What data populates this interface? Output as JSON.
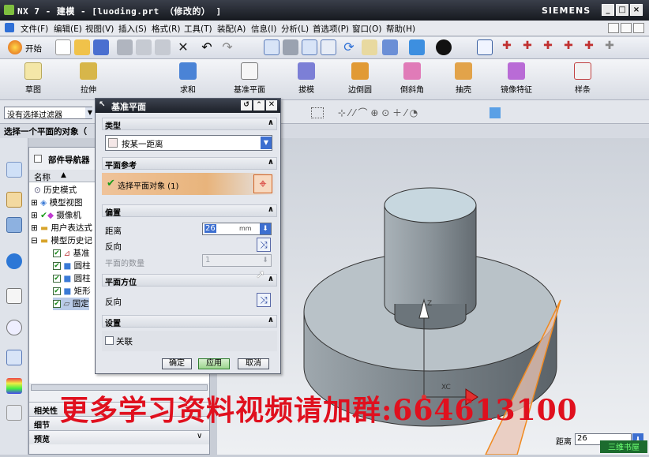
{
  "window": {
    "title": "NX 7 - 建模 - [luoding.prt （修改的） ]",
    "brand": "SIEMENS",
    "controls": [
      "_",
      "□",
      "×"
    ]
  },
  "menubar": {
    "items": [
      "文件(F)",
      "编辑(E)",
      "视图(V)",
      "插入(S)",
      "格式(R)",
      "工具(T)",
      "装配(A)",
      "信息(I)",
      "分析(L)",
      "首选项(P)",
      "窗口(O)",
      "帮助(H)"
    ]
  },
  "toolbar1": {
    "start_label": "开始"
  },
  "toolbar2": {
    "items": [
      "草图",
      "拉伸",
      "求和",
      "基准平面",
      "拔模",
      "边倒圆",
      "倒斜角",
      "抽壳",
      "镜像特征",
      "样条"
    ]
  },
  "filter": {
    "value": "没有选择过滤器"
  },
  "status": {
    "prompt": "选择一个平面的对象（"
  },
  "navigator": {
    "title": "部件导航器",
    "column_name": "名称",
    "rows": [
      {
        "label": "历史模式"
      },
      {
        "label": "模型视图"
      },
      {
        "label": "摄像机"
      },
      {
        "label": "用户表达式"
      },
      {
        "label": "模型历史记"
      },
      {
        "label": "基准"
      },
      {
        "label": "圆柱"
      },
      {
        "label": "圆柱"
      },
      {
        "label": "矩形"
      },
      {
        "label": "固定"
      }
    ],
    "panels": [
      "相关性",
      "细节",
      "预览"
    ]
  },
  "dialog": {
    "title": "基准平面",
    "sections": {
      "type": {
        "header": "类型",
        "value": "按某一距离"
      },
      "plane_ref": {
        "header": "平面参考",
        "select_label": "选择平面对象 (1)"
      },
      "offset": {
        "header": "偏置",
        "distance_label": "距离",
        "distance_value": "26",
        "distance_unit": "mm",
        "reverse_label": "反向",
        "count_label": "平面的数量",
        "count_value": "1"
      },
      "plane_orient": {
        "header": "平面方位",
        "reverse_label": "反向"
      },
      "settings": {
        "header": "设置",
        "associative_label": "关联"
      }
    },
    "buttons": {
      "ok": "确定",
      "apply": "应用",
      "cancel": "取消"
    }
  },
  "viewport": {
    "distance_label": "距离",
    "distance_value": "26",
    "axis_labels": {
      "z": "Z",
      "xc": "XC"
    }
  },
  "watermark": "更多学习资料视频请加群:664613100",
  "corner_badge": "三维书屋"
}
